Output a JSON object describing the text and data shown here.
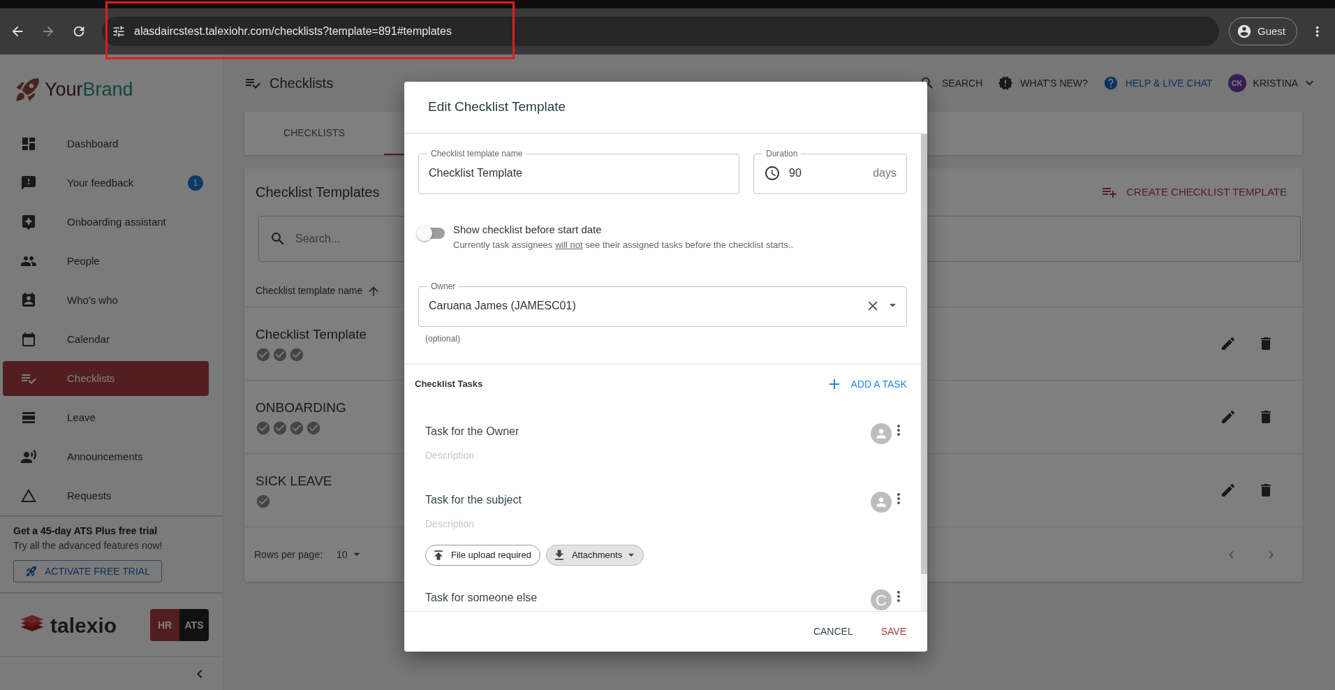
{
  "browser": {
    "url": "alasdaircstest.talexiohr.com/checklists?template=891#templates",
    "profile": "Guest"
  },
  "sidebar": {
    "brand": [
      "Your",
      "Brand"
    ],
    "items": [
      {
        "label": "Dashboard",
        "selected": false
      },
      {
        "label": "Your feedback",
        "selected": false,
        "badge": "1"
      },
      {
        "label": "Onboarding assistant",
        "selected": false
      },
      {
        "label": "People",
        "selected": false
      },
      {
        "label": "Who's who",
        "selected": false
      },
      {
        "label": "Calendar",
        "selected": false
      },
      {
        "label": "Checklists",
        "selected": true
      },
      {
        "label": "Leave",
        "selected": false
      },
      {
        "label": "Announcements",
        "selected": false
      },
      {
        "label": "Requests",
        "selected": false
      }
    ],
    "trial": {
      "title": "Get a 45-day ATS Plus free trial",
      "text": "Try all the advanced features now!",
      "button": "ACTIVATE FREE TRIAL"
    },
    "footer": {
      "logo": "talexio",
      "products": [
        {
          "label": "HR",
          "selected": true
        },
        {
          "label": "ATS",
          "selected": false
        }
      ]
    }
  },
  "header": {
    "title": "Checklists",
    "actions": [
      {
        "label": "SEARCH",
        "kind": "plain"
      },
      {
        "label": "WHAT'S NEW?",
        "kind": "plain"
      },
      {
        "label": "HELP & LIVE CHAT",
        "kind": "link"
      }
    ],
    "user": {
      "initials": "CK",
      "name": "KRISTINA"
    }
  },
  "tabs": [
    {
      "label": "CHECKLISTS",
      "selected": false
    },
    {
      "selected": true
    }
  ],
  "templates": {
    "title": "Checklist Templates",
    "create_button": "CREATE CHECKLIST TEMPLATE",
    "search_placeholder": "Search...",
    "column": "Checklist template name",
    "rows": [
      {
        "name": "Checklist Template",
        "steps": [
          {
            "done": true
          },
          {
            "done": true
          },
          {
            "done": true
          }
        ]
      },
      {
        "name": "ONBOARDING",
        "steps": [
          {
            "done": true
          },
          {
            "done": true
          },
          {
            "done": true
          },
          {
            "done": true
          }
        ]
      },
      {
        "name": "SICK LEAVE",
        "steps": [
          {
            "done": true
          }
        ]
      }
    ],
    "rows_per_page_label": "Rows per page:",
    "rows_per_page": "10"
  },
  "dialog": {
    "title": "Edit Checklist Template",
    "name_field": {
      "label": "Checklist template name",
      "value": "Checklist Template"
    },
    "duration_field": {
      "label": "Duration",
      "value": "90",
      "suffix": "days"
    },
    "toggle": {
      "label": "Show checklist before start date",
      "hint": [
        "Currently task assignees ",
        "will not",
        " see their assigned tasks before the checklist starts.."
      ],
      "on": false
    },
    "owner_field": {
      "label": "Owner",
      "value": "Caruana James (JAMESC01)",
      "helper": "(optional)"
    },
    "tasks_title": "Checklist Tasks",
    "add_task": "ADD A TASK",
    "tasks": [
      {
        "title": "Task for the Owner",
        "description_placeholder": "Description",
        "assignee": {
          "kind": "person"
        }
      },
      {
        "title": "Task for the subject",
        "description_placeholder": "Description",
        "assignee": {
          "kind": "person"
        },
        "chips": [
          {
            "label": "File upload required",
            "kind": "upload"
          },
          {
            "label": "Attachments",
            "kind": "attachments"
          }
        ]
      },
      {
        "title": "Task for someone else",
        "assignee": {
          "kind": "initial",
          "initial": "C"
        }
      }
    ],
    "cancel": "CANCEL",
    "save": "SAVE"
  }
}
